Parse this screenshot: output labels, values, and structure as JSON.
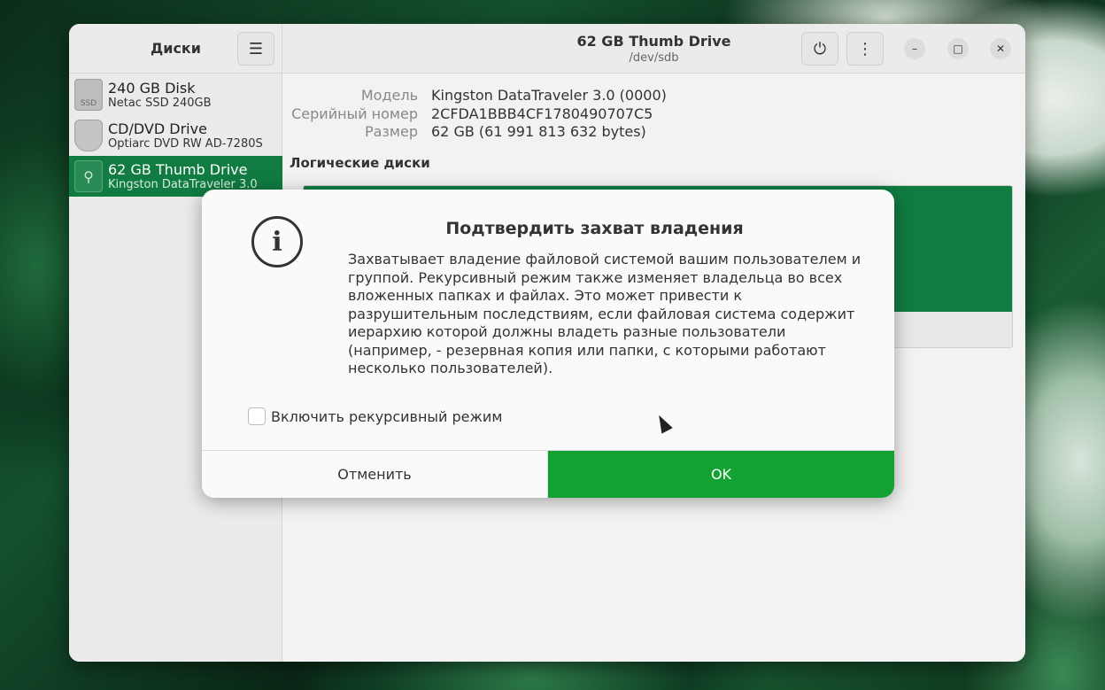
{
  "sidebar": {
    "title": "Диски",
    "menu_icon": "☰",
    "disks": [
      {
        "name": "240 GB Disk",
        "sub": "Netac SSD 240GB",
        "icon_label": "SSD"
      },
      {
        "name": "CD/DVD Drive",
        "sub": "Optiarc DVD RW AD-7280S",
        "icon_label": ""
      },
      {
        "name": "62 GB Thumb Drive",
        "sub": "Kingston DataTraveler 3.0",
        "icon_label": "⚲"
      }
    ]
  },
  "header": {
    "title": "62 GB Thumb Drive",
    "subtitle": "/dev/sdb",
    "power_icon": "⏻",
    "more_icon": "⋮",
    "minimize_icon": "–",
    "maximize_icon": "□",
    "close_icon": "✕"
  },
  "info": {
    "model_label": "Модель",
    "model_value": "Kingston DataTraveler 3.0 (0000)",
    "serial_label": "Серийный номер",
    "serial_value": "2CFDA1BBB4CF1780490707C5",
    "size_label": "Размер",
    "size_value": "62 GB (61 991 813 632 bytes)"
  },
  "volumes": {
    "title": "Логические диски"
  },
  "dialog": {
    "icon": "i",
    "title": "Подтвердить захват владения",
    "text": "Захватывает владение файловой системой вашим пользователем и группой. Рекурсивный режим также изменяет владельца во всех вложенных папках и файлах. Это может привести к разрушительным последствиям, если файловая система содержит иерархию которой должны владеть разные пользователи (например, - резервная копия или папки, с которыми работают несколько пользователей).",
    "checkbox_label": "Включить рекурсивный режим",
    "cancel_label": "Отменить",
    "ok_label": "OK"
  },
  "colors": {
    "accent": "#107c41",
    "ok_button": "#13a131"
  }
}
